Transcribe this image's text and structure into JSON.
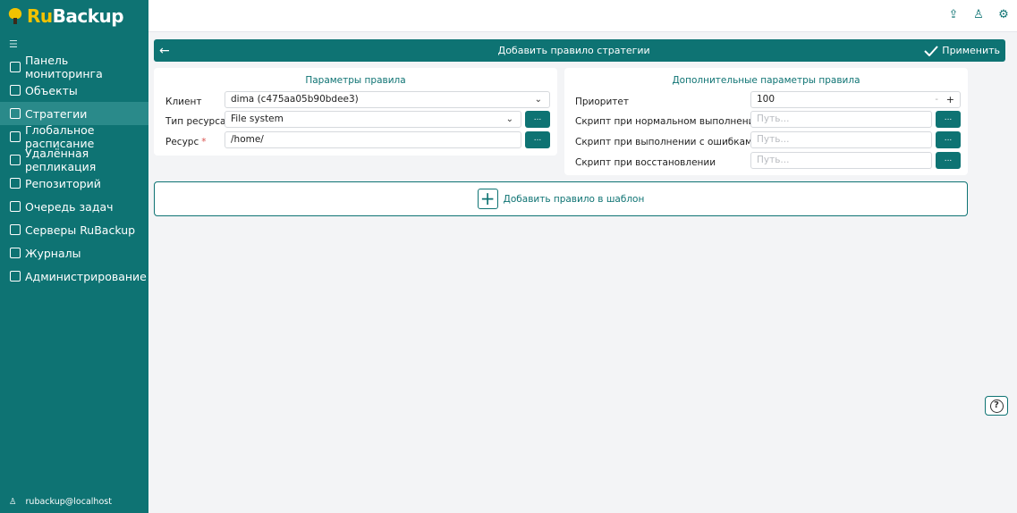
{
  "app": {
    "logo_ru": "Ru",
    "logo_backup": "Backup"
  },
  "sidebar": {
    "collapse_icon": "collapse-icon",
    "items": [
      {
        "label": "Панель мониторинга",
        "icon": "dashboard-icon"
      },
      {
        "label": "Объекты",
        "icon": "monitor-icon"
      },
      {
        "label": "Стратегии",
        "icon": "strategy-icon",
        "active": true
      },
      {
        "label": "Глобальное расписание",
        "icon": "schedule-icon"
      },
      {
        "label": "Удалённая репликация",
        "icon": "replication-icon"
      },
      {
        "label": "Репозиторий",
        "icon": "repository-icon"
      },
      {
        "label": "Очередь задач",
        "icon": "task-queue-icon"
      },
      {
        "label": "Серверы RuBackup",
        "icon": "servers-icon"
      },
      {
        "label": "Журналы",
        "icon": "logs-icon"
      },
      {
        "label": "Администрирование",
        "icon": "admin-icon"
      }
    ],
    "user": "rubackup@localhost"
  },
  "topbar": {
    "icons": [
      "upload-icon",
      "user-icon",
      "settings-icon"
    ]
  },
  "header": {
    "title": "Добавить правило стратегии",
    "apply_label": "Применить"
  },
  "rule_params": {
    "title": "Параметры правила",
    "client_label": "Клиент",
    "client_value": "dima (c475aa05b90bdee3)",
    "resource_type_label": "Тип ресурса",
    "resource_type_value": "File system",
    "resource_label": "Ресурс",
    "resource_required": "*",
    "resource_value": "/home/",
    "dots": "..."
  },
  "extra_params": {
    "title": "Дополнительные параметры правила",
    "priority_label": "Приоритет",
    "priority_value": "100",
    "stepper_minus": "-",
    "stepper_plus": "+",
    "script_normal_label": "Скрипт при нормальном выполнении",
    "script_error_label": "Скрипт при выполнении с ошибками",
    "script_restore_label": "Скрипт при восстановлении",
    "path_placeholder": "Путь..."
  },
  "add_rule": {
    "plus": "+",
    "label": "Добавить правило в шаблон"
  },
  "help": {
    "symbol": "?"
  },
  "colors": {
    "accent": "#0e7373",
    "active_item": "#2a8a8a",
    "logo_yellow": "#f2c200"
  }
}
